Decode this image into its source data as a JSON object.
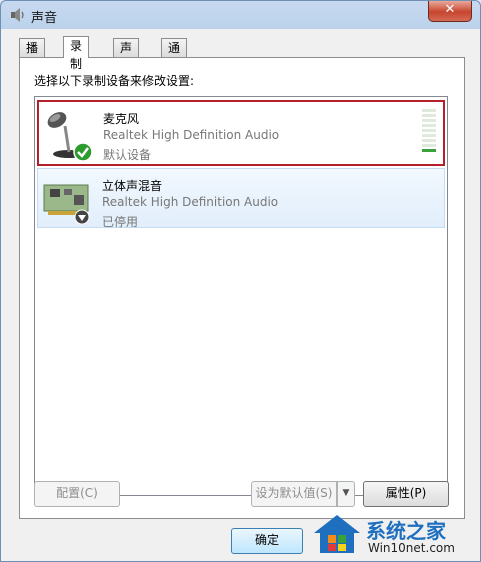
{
  "window": {
    "title": "声音",
    "close_label": "✕"
  },
  "tabs": [
    {
      "label": "播放",
      "active": false
    },
    {
      "label": "录制",
      "active": true
    },
    {
      "label": "声音",
      "active": false
    },
    {
      "label": "通信",
      "active": false
    }
  ],
  "instruction": "选择以下录制设备来修改设置:",
  "devices": [
    {
      "name": "麦克风",
      "driver": "Realtek High Definition Audio",
      "status": "默认设备",
      "icon": "microphone-icon",
      "badge": "default-check",
      "selected": true,
      "level": 0.1
    },
    {
      "name": "立体声混音",
      "driver": "Realtek High Definition Audio",
      "status": "已停用",
      "icon": "sound-card-icon",
      "badge": "disabled-arrow",
      "selected": false
    }
  ],
  "buttons": {
    "configure": "配置(C)",
    "set_default": "设为默认值(S)",
    "properties": "属性(P)",
    "ok": "确定"
  },
  "watermark": {
    "brand": "系统之家",
    "url": "Win10net.com"
  },
  "colors": {
    "selection_border": "#b3202a",
    "check_green": "#2e9b2e",
    "accent_blue": "#1f6fbf"
  }
}
